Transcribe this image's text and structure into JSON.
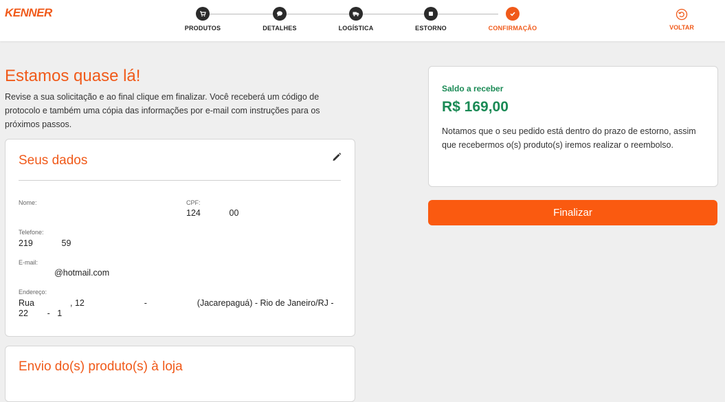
{
  "header": {
    "logo": "KENNER",
    "steps": [
      {
        "label": "PRODUTOS",
        "icon": "cart-icon",
        "active": false
      },
      {
        "label": "DETALHES",
        "icon": "chat-icon",
        "active": false
      },
      {
        "label": "LOGÍSTICA",
        "icon": "truck-icon",
        "active": false
      },
      {
        "label": "ESTORNO",
        "icon": "stop-icon",
        "active": false
      },
      {
        "label": "CONFIRMAÇÃO",
        "icon": "check-icon",
        "active": true
      }
    ],
    "back_label": "VOLTAR"
  },
  "main": {
    "title": "Estamos quase lá!",
    "intro": "Revise a sua solicitação e ao final clique em finalizar. Você receberá um código de protocolo e também uma cópia das informações por e-mail com instruções para os próximos passos.",
    "seus_dados": {
      "title": "Seus dados",
      "nome_label": "Nome:",
      "nome_value": "",
      "cpf_label": "CPF:",
      "cpf_value": "124            00",
      "telefone_label": "Telefone:",
      "telefone_value": "219            59",
      "email_label": "E-mail:",
      "email_value": "               @hotmail.com",
      "endereco_label": "Endereço:",
      "endereco_line1": "Rua               , 12                         -                     (Jacarepaguá) - Rio de Janeiro/RJ -",
      "endereco_line2": "22        -   1"
    },
    "envio_title": "Envio do(s) produto(s) à loja"
  },
  "side": {
    "saldo_label": "Saldo a receber",
    "saldo_value": "R$ 169,00",
    "saldo_text": "Notamos que o seu pedido está dentro do prazo de estorno, assim que recebermos o(s) produto(s) iremos realizar o reembolso.",
    "finalizar_label": "Finalizar"
  },
  "colors": {
    "brand": "#f05a1a",
    "button": "#fa5a10",
    "money": "#1a8a55"
  }
}
